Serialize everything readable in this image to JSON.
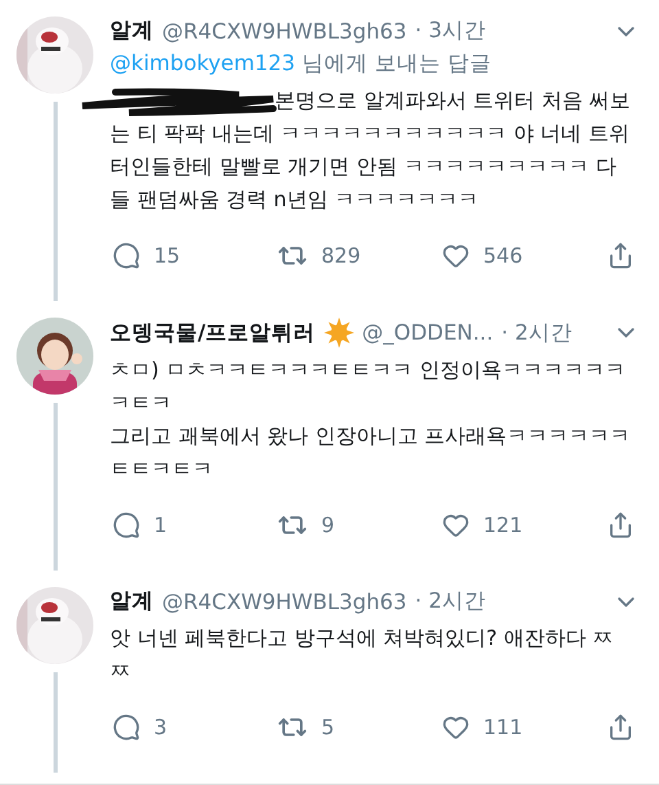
{
  "tweets": [
    {
      "name": "알계",
      "handle": "@R4CXW9HWBL3gh63",
      "time": "· 3시간",
      "badge": false,
      "reply_to": {
        "mention": "@kimbokyem123",
        "suffix": "님에게 보내는 답글"
      },
      "redacted": true,
      "body": "본명으로 알계파와서 트위터 처음 써보는 티 팍팍 내는데 ㅋㅋㅋㅋㅋㅋㅋㅋㅋㅋㅋ 야 너네 트위터인들한테 말빨로 개기면 안됨 ㅋㅋㅋㅋㅋㅋㅋㅋㅋ 다들 팬덤싸움 경력 n년임 ㅋㅋㅋㅋㅋㅋㅋ",
      "replies": "15",
      "retweets": "829",
      "likes": "546"
    },
    {
      "name": "오뎅국물/프로알튀러",
      "handle": "@_ODDEN...",
      "time": "· 2시간",
      "badge": true,
      "redacted": false,
      "body": "ㅊㅁ) ㅁㅊㅋㅋㅌㅋㅋㅋㅌㅌㅋㅋ 인정이욕ㅋㅋㅋㅋㅋㅋㅋㅌㅋ\n그리고 괘북에서 왔나 인장아니고 프사래욕ㅋㅋㅋㅋㅋㅋㅌㅌㅋㅌㅋ",
      "replies": "1",
      "retweets": "9",
      "likes": "121"
    },
    {
      "name": "알계",
      "handle": "@R4CXW9HWBL3gh63",
      "time": "· 2시간",
      "badge": false,
      "redacted": false,
      "body": "앗 너넨 페북한다고 방구석에 쳐박혀있디? 애잔하다 ㅉㅉ",
      "replies": "3",
      "retweets": "5",
      "likes": "111"
    }
  ]
}
